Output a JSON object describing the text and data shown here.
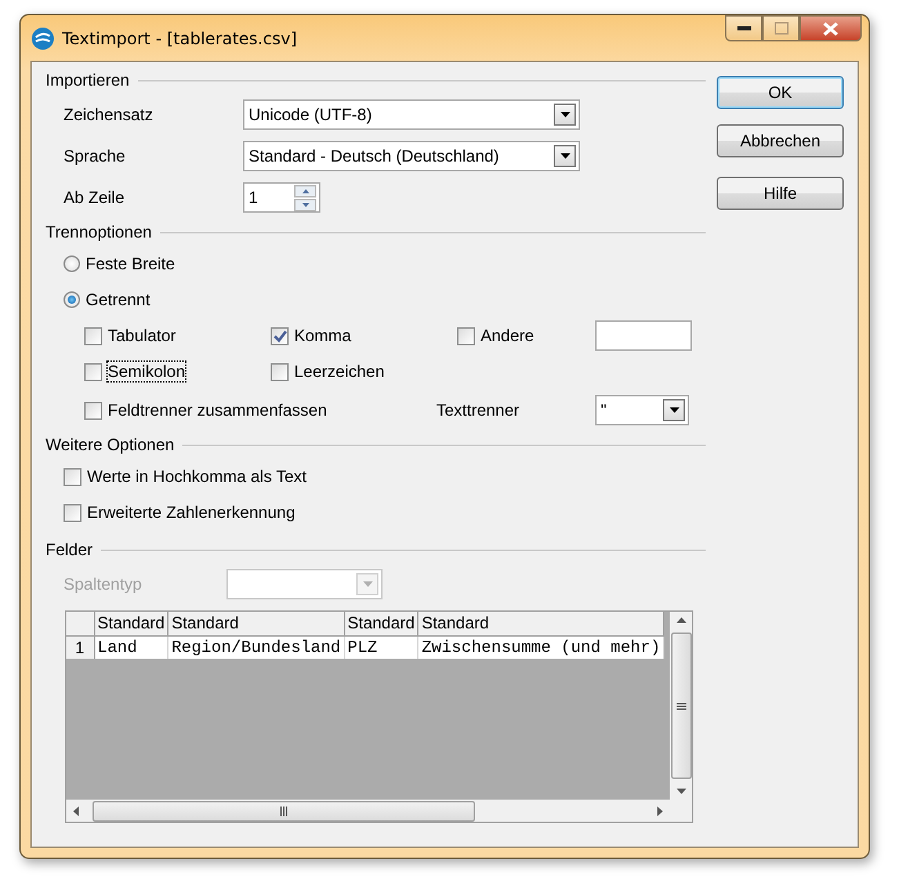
{
  "window": {
    "title": "Textimport - [tablerates.csv]"
  },
  "import": {
    "heading": "Importieren",
    "charset": {
      "label": "Zeichensatz",
      "value": "Unicode (UTF-8)"
    },
    "language": {
      "label": "Sprache",
      "value": "Standard - Deutsch (Deutschland)"
    },
    "from_row": {
      "label": "Ab Zeile",
      "value": "1"
    }
  },
  "separator_options": {
    "heading": "Trennoptionen",
    "modes": [
      {
        "label": "Feste Breite",
        "selected": false
      },
      {
        "label": "Getrennt",
        "selected": true
      }
    ],
    "separators": [
      {
        "label": "Tabulator",
        "checked": false,
        "focused": false
      },
      {
        "label": "Komma",
        "checked": true,
        "focused": false
      },
      {
        "label": "Andere",
        "checked": false,
        "focused": false
      },
      {
        "label": "Semikolon",
        "checked": false,
        "focused": true
      },
      {
        "label": "Leerzeichen",
        "checked": false,
        "focused": false
      }
    ],
    "merge": {
      "label": "Feldtrenner zusammenfassen",
      "checked": false
    },
    "text_delimiter": {
      "label": "Texttrenner",
      "value": "\""
    }
  },
  "more_options": {
    "heading": "Weitere Optionen",
    "options": [
      {
        "label": "Werte in Hochkomma als Text",
        "checked": false
      },
      {
        "label": "Erweiterte Zahlenerkennung",
        "checked": false
      }
    ]
  },
  "fields": {
    "heading": "Felder",
    "column_type": {
      "label": "Spaltentyp",
      "disabled": true
    },
    "table": {
      "columns": [
        "Standard",
        "Standard",
        "Standard",
        "Standard"
      ],
      "rows": [
        {
          "number": "1",
          "cells": [
            "Land",
            "Region/Bundesland",
            "PLZ",
            "Zwischensumme (und mehr)"
          ]
        }
      ]
    }
  },
  "buttons": [
    {
      "label": "OK",
      "default": true
    },
    {
      "label": "Abbrechen",
      "default": false
    },
    {
      "label": "Hilfe",
      "default": false
    }
  ]
}
